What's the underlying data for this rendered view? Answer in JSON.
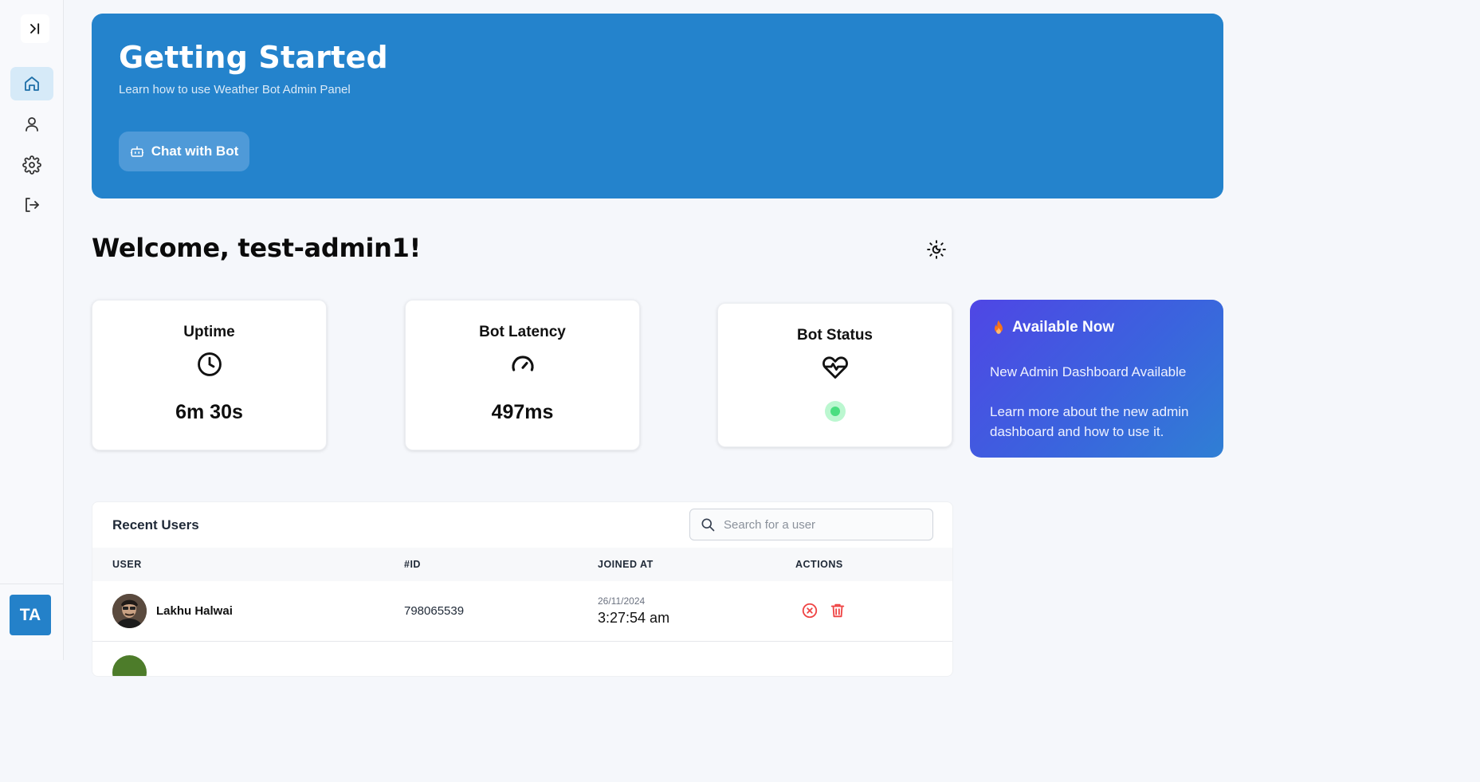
{
  "hero": {
    "title": "Getting Started",
    "subtitle": "Learn how to use Weather Bot Admin Panel",
    "button_label": "Chat with Bot"
  },
  "welcome": "Welcome, test-admin1!",
  "stats": {
    "uptime": {
      "title": "Uptime",
      "value": "6m 30s",
      "icon": "clock-icon"
    },
    "latency": {
      "title": "Bot Latency",
      "value": "497ms",
      "icon": "gauge-icon"
    },
    "status": {
      "title": "Bot Status",
      "icon": "heart-pulse-icon",
      "state": "online",
      "color": "#4ade80"
    }
  },
  "promo": {
    "title": "Available Now",
    "line1": "New Admin Dashboard Available",
    "line2": "Learn more about the new admin dashboard and how to use it.",
    "icon": "flame-icon"
  },
  "sidebar": {
    "avatar_initials": "TA",
    "items": [
      {
        "icon": "home-icon",
        "active": true
      },
      {
        "icon": "user-icon",
        "active": false
      },
      {
        "icon": "settings-icon",
        "active": false
      },
      {
        "icon": "logout-icon",
        "active": false
      }
    ]
  },
  "users_table": {
    "title": "Recent Users",
    "search_placeholder": "Search for a user",
    "columns": [
      "USER",
      "#ID",
      "JOINED AT",
      "ACTIONS"
    ],
    "rows": [
      {
        "name": "Lakhu Halwai",
        "id": "798065539",
        "date": "26/11/2024",
        "time": "3:27:54 am"
      }
    ]
  },
  "colors": {
    "primary": "#2483cc",
    "danger": "#ef4444",
    "promo_gradient": [
      "#4f46e5",
      "#2f7fd4"
    ]
  }
}
